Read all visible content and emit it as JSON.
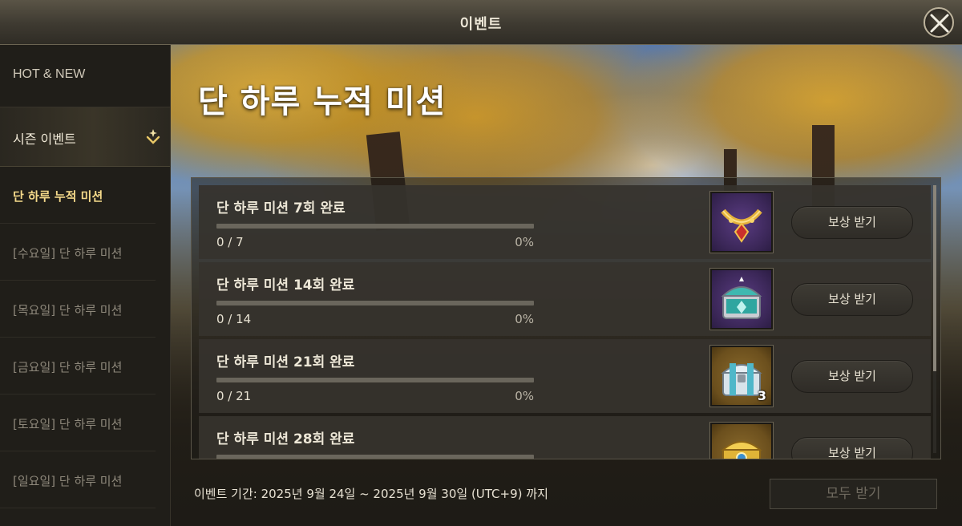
{
  "window": {
    "title": "이벤트"
  },
  "sidebar": {
    "hot_new": "HOT & NEW",
    "season_event": "시즌 이벤트",
    "items": [
      {
        "label": "단 하루 누적 미션",
        "active": true
      },
      {
        "label": "[수요일] 단 하루 미션",
        "active": false
      },
      {
        "label": "[목요일] 단 하루 미션",
        "active": false
      },
      {
        "label": "[금요일] 단 하루 미션",
        "active": false
      },
      {
        "label": "[토요일] 단 하루 미션",
        "active": false
      },
      {
        "label": "[일요일] 단 하루 미션",
        "active": false
      }
    ]
  },
  "main": {
    "event_title": "단 하루 누적 미션",
    "missions": [
      {
        "title": "단 하루 미션 7회 완료",
        "count": "0 / 7",
        "percent": "0%",
        "progress": 0,
        "reward_icon": "gold-necklace-icon",
        "reward_qty": "",
        "claim_label": "보상 받기"
      },
      {
        "title": "단 하루 미션 14회 완료",
        "count": "0 / 14",
        "percent": "0%",
        "progress": 0,
        "reward_icon": "teal-chest-icon",
        "reward_qty": "",
        "claim_label": "보상 받기"
      },
      {
        "title": "단 하루 미션 21회 완료",
        "count": "0 / 21",
        "percent": "0%",
        "progress": 0,
        "reward_icon": "silver-chest-icon",
        "reward_qty": "3",
        "claim_label": "보상 받기"
      },
      {
        "title": "단 하루 미션 28회 완료",
        "count": "",
        "percent": "",
        "progress": 0,
        "reward_icon": "gold-chest-icon",
        "reward_qty": "",
        "claim_label": "보상 받기"
      }
    ],
    "event_period": "이벤트 기간: 2025년 9월 24일 ~ 2025년 9월 30일 (UTC+9) 까지",
    "claim_all_label": "모두 받기"
  },
  "colors": {
    "accent_gold": "#f4d98a",
    "progress_fill": "#e0c36c"
  }
}
